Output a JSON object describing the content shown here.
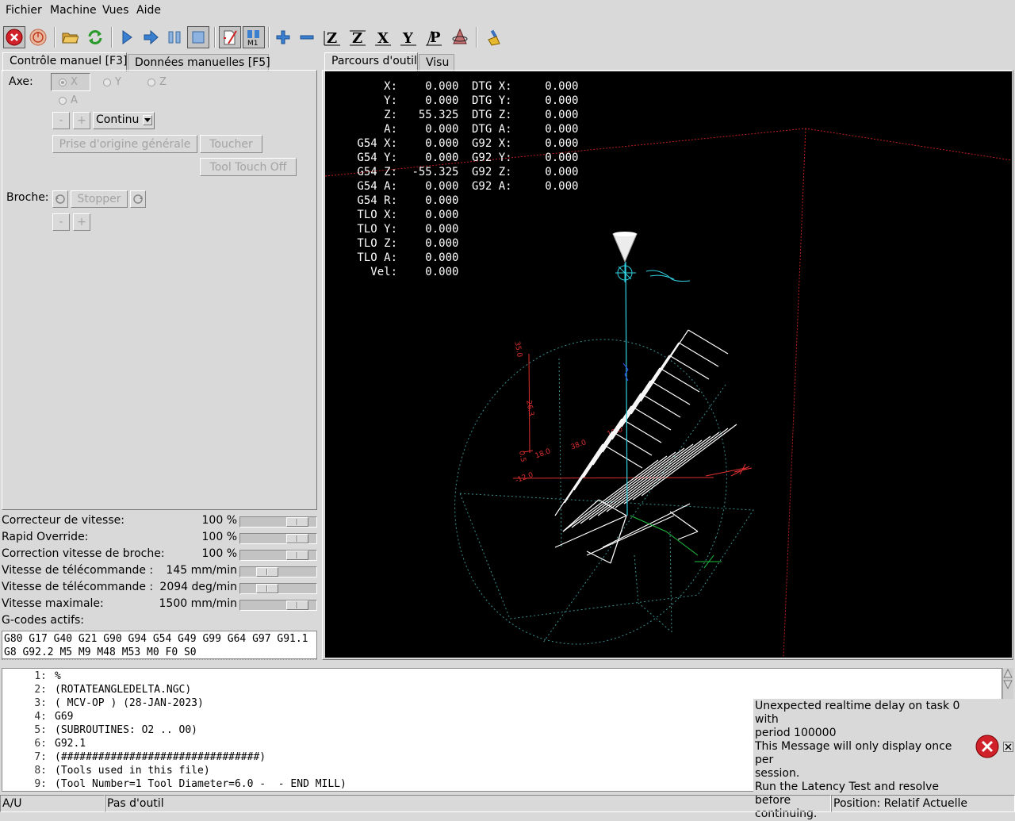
{
  "menubar": {
    "items": [
      {
        "label": "Fichier"
      },
      {
        "label": "Machine"
      },
      {
        "label": "Vues"
      },
      {
        "label": "Aide"
      }
    ]
  },
  "toolbar": {
    "icons": [
      "estop-icon",
      "power-icon",
      "open-file-icon",
      "reload-icon",
      "run-icon",
      "step-icon",
      "pause-icon",
      "stop-icon",
      "block-delete-icon",
      "optional-stop-icon",
      "zoom-in-icon",
      "zoom-out-icon",
      "view-z-icon",
      "view-z2-icon",
      "view-x-icon",
      "view-y-icon",
      "view-p-icon",
      "rotate-view-icon",
      "clear-plot-icon"
    ]
  },
  "left_tabs": [
    {
      "label": "Contrôle manuel [F3]"
    },
    {
      "label": "Données manuelles [F5]"
    }
  ],
  "right_tabs": [
    {
      "label": "Parcours d'outil"
    },
    {
      "label": "Visu"
    }
  ],
  "manual": {
    "axis_label": "Axe:",
    "axes": [
      {
        "label": "X",
        "selected": true
      },
      {
        "label": "Y",
        "selected": false
      },
      {
        "label": "Z",
        "selected": false
      },
      {
        "label": "A",
        "selected": false
      }
    ],
    "jog_minus": "-",
    "jog_plus": "+",
    "jog_mode": "Continu",
    "home_all": "Prise d'origine générale",
    "touch_off": "Toucher",
    "tool_touch_off": "Tool Touch Off",
    "spindle_label": "Broche:",
    "spindle_stop": "Stopper",
    "spindle_minus": "-",
    "spindle_plus": "+"
  },
  "sliders": [
    {
      "label": "Correcteur de vitesse:",
      "value": "100 %",
      "fraction": 1.0
    },
    {
      "label": "Rapid Override:",
      "value": "100 %",
      "fraction": 1.0
    },
    {
      "label": "Correction vitesse de broche:",
      "value": "100 %",
      "fraction": 1.0
    },
    {
      "label": "Vitesse de télécommande :",
      "value": "145 mm/min",
      "fraction": 0.32
    },
    {
      "label": "Vitesse de télécommande :",
      "value": "2094 deg/min",
      "fraction": 0.32
    },
    {
      "label": "Vitesse maximale:",
      "value": "1500 mm/min",
      "fraction": 1.0
    }
  ],
  "gcodes": {
    "label": "G-codes actifs:",
    "line1": "G80 G17 G40 G21 G90 G94 G54 G49 G99 G64 G97 G91.1",
    "line2": "G8 G92.2 M5 M9 M48 M53 M0 F0 S0"
  },
  "dro": {
    "left": [
      {
        "label": "     X:",
        "value": "   0.000"
      },
      {
        "label": "     Y:",
        "value": "   0.000"
      },
      {
        "label": "     Z:",
        "value": "  55.325"
      },
      {
        "label": "     A:",
        "value": "   0.000"
      },
      {
        "label": " G54 X:",
        "value": "   0.000"
      },
      {
        "label": " G54 Y:",
        "value": "   0.000"
      },
      {
        "label": " G54 Z:",
        "value": " -55.325"
      },
      {
        "label": " G54 A:",
        "value": "   0.000"
      },
      {
        "label": " G54 R:",
        "value": "   0.000"
      },
      {
        "label": " TLO X:",
        "value": "   0.000"
      },
      {
        "label": " TLO Y:",
        "value": "   0.000"
      },
      {
        "label": " TLO Z:",
        "value": "   0.000"
      },
      {
        "label": " TLO A:",
        "value": "   0.000"
      },
      {
        "label": "   Vel:",
        "value": "   0.000"
      }
    ],
    "right": [
      {
        "label": "DTG X:",
        "value": "    0.000"
      },
      {
        "label": "DTG Y:",
        "value": "    0.000"
      },
      {
        "label": "DTG Z:",
        "value": "    0.000"
      },
      {
        "label": "DTG A:",
        "value": "    0.000"
      },
      {
        "label": "G92 X:",
        "value": "    0.000"
      },
      {
        "label": "G92 Y:",
        "value": "    0.000"
      },
      {
        "label": "G92 Z:",
        "value": "    0.000"
      },
      {
        "label": "G92 A:",
        "value": "    0.000"
      }
    ]
  },
  "listing": [
    {
      "num": "1:",
      "text": "%"
    },
    {
      "num": "2:",
      "text": "(ROTATEANGLEDELTA.NGC)"
    },
    {
      "num": "3:",
      "text": "( MCV-OP ) (28-JAN-2023)"
    },
    {
      "num": "4:",
      "text": "G69"
    },
    {
      "num": "5:",
      "text": "(SUBROUTINES: O2 .. O0)"
    },
    {
      "num": "6:",
      "text": "G92.1"
    },
    {
      "num": "7:",
      "text": "(################################)"
    },
    {
      "num": "8:",
      "text": "(Tools used in this file)"
    },
    {
      "num": "9:",
      "text": "(Tool Number=1 Tool Diameter=6.0 -  - END MILL)"
    }
  ],
  "message": {
    "text1": "Unexpected realtime delay on task 0 with",
    "text2": "period 100000",
    "text3": "This Message will only display once per",
    "text4": "session.",
    "text5": "Run the Latency Test and resolve before",
    "text6": "continuing."
  },
  "statusbar": {
    "mode": "A/U",
    "tool": "Pas d'outil",
    "position": "Position: Relatif Actuelle"
  },
  "preview_labels": {
    "y_top": "35.0",
    "y_mid": "26.3",
    "y_low": "0.5",
    "x_left": "-12.0",
    "x_mid": "18.0",
    "x_r1": "38.0",
    "z_lbl": "10.0",
    "g54": "G54"
  },
  "colors": {
    "estop": "#d0202a",
    "play": "#2a6fc0",
    "path": "#ffffff",
    "axis_red": "#e03030",
    "cyan": "#30d0e0",
    "dotted_cyan": "#3a8f8f"
  }
}
